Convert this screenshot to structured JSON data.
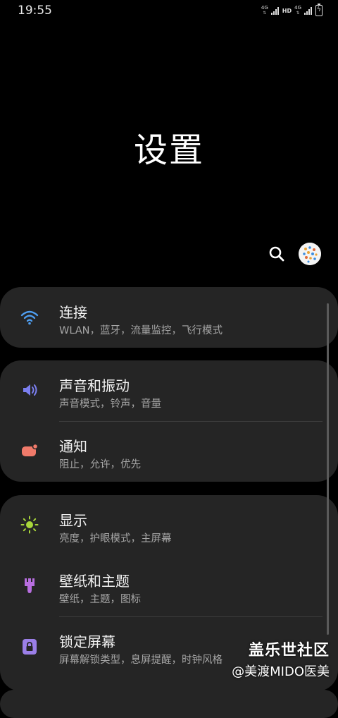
{
  "status_bar": {
    "time": "19:55",
    "net1": "4G",
    "net2": "4G",
    "hd": "HD"
  },
  "page_title": "设置",
  "sections": [
    {
      "items": [
        {
          "title": "连接",
          "subtitle": "WLAN，蓝牙，流量监控，飞行模式",
          "icon": "wifi-icon",
          "color": "#4f9ef0"
        }
      ]
    },
    {
      "items": [
        {
          "title": "声音和振动",
          "subtitle": "声音模式，铃声，音量",
          "icon": "volume-icon",
          "color": "#7b7ff0"
        },
        {
          "title": "通知",
          "subtitle": "阻止，允许，优先",
          "icon": "notification-icon",
          "color": "#f07a6a"
        }
      ]
    },
    {
      "items": [
        {
          "title": "显示",
          "subtitle": "亮度，护眼模式，主屏幕",
          "icon": "brightness-icon",
          "color": "#a8d63a"
        },
        {
          "title": "壁纸和主题",
          "subtitle": "壁纸，主题，图标",
          "icon": "brush-icon",
          "color": "#b86ee0"
        },
        {
          "title": "锁定屏幕",
          "subtitle": "屏幕解锁类型，息屏提醒，时钟风格",
          "icon": "lock-icon",
          "color": "#9b7fe8"
        }
      ]
    }
  ],
  "watermark": {
    "line1": "盖乐世社区",
    "line2": "@美渡MIDO医美"
  }
}
